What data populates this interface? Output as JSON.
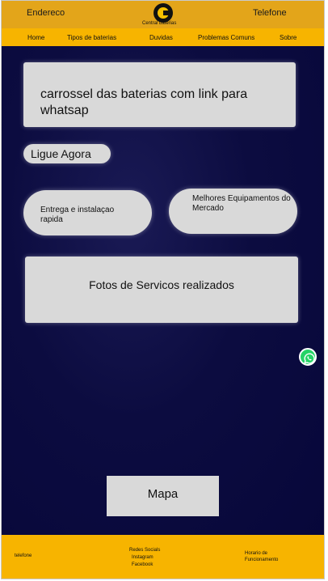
{
  "header": {
    "address_label": "Endereco",
    "phone_label": "Telefone",
    "logo_text": "Central baterias"
  },
  "nav": {
    "items": [
      "Home",
      "Tipos de baterias",
      "Duvidas",
      "Problemas Comuns",
      "Sobre"
    ]
  },
  "main": {
    "carousel_text": "carrossel das baterias com link para whatsap",
    "call_button": "Ligue Agora",
    "feature_1": "Entrega e instalaçao rapida",
    "feature_2": "Melhores Equipamentos do Mercado",
    "photos_text": "Fotos de Servicos realizados",
    "map_button": "Mapa",
    "whatsapp_icon": "whatsapp-icon"
  },
  "footer": {
    "phone": "telefone",
    "social_title": "Redes Socials",
    "social_instagram": "Instagram",
    "social_facebook": "Facebook",
    "hours_line1": "Horario de",
    "hours_line2": "Funcionamento"
  },
  "colors": {
    "topbar": "#e3a51a",
    "nav": "#f7b400",
    "background": "#07073a",
    "card": "#d9d9d9",
    "whatsapp": "#25d366"
  }
}
